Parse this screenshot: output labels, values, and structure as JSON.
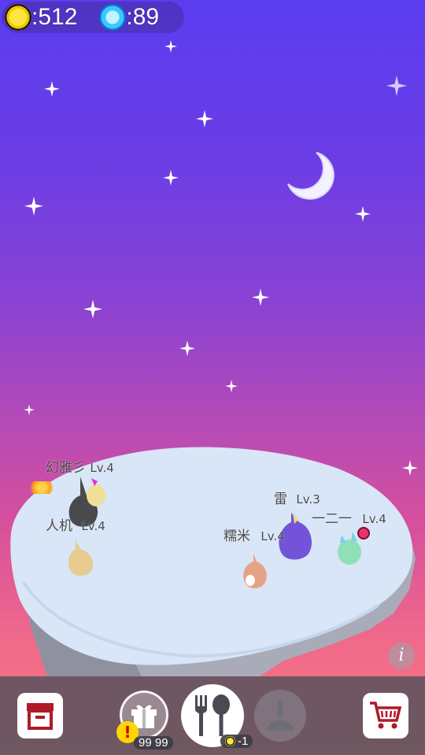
{
  "hud": {
    "coins": ":512",
    "gems": ":89",
    "coin_icon": "gold-coin-icon",
    "gem_icon": "blue-gem-icon"
  },
  "players": [
    {
      "name": "幻雅彡",
      "level": "Lv.4"
    },
    {
      "name": "人机",
      "level": "Lv.4"
    },
    {
      "name": "雷",
      "level": "Lv.3"
    },
    {
      "name": "一二一",
      "level": "Lv.4"
    },
    {
      "name": "糯米",
      "level": "Lv.4"
    }
  ],
  "toolbar": {
    "storage_icon": "storage-box-icon",
    "gift_icon": "gift-icon",
    "gift_alert": "!",
    "gift_count": "99 99",
    "feed_icon": "fork-spoon-icon",
    "feed_cost": "-1",
    "clean_icon": "plunger-icon",
    "shop_icon": "shopping-cart-icon"
  },
  "info_label": "i",
  "colors": {
    "sky_top": "#5b3df0",
    "sky_bottom": "#f5787e",
    "platform": "#d8e6f7",
    "toolbar_bg": "#50505a"
  }
}
